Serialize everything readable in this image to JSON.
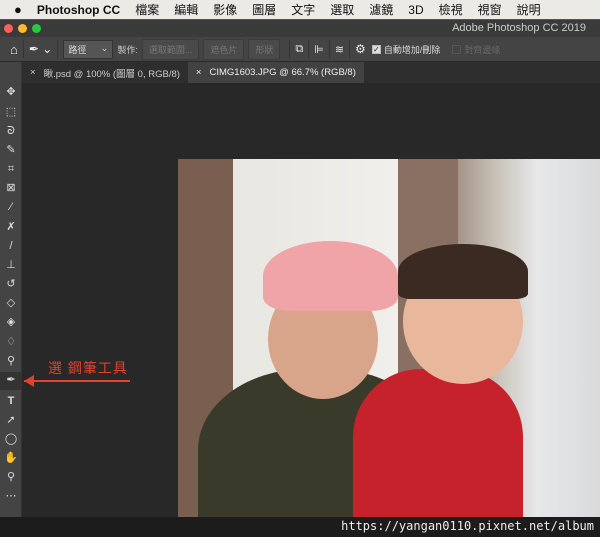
{
  "menubar": {
    "apple_icon": "apple-icon",
    "app": "Photoshop CC",
    "items": [
      "檔案",
      "編輯",
      "影像",
      "圖層",
      "文字",
      "選取",
      "濾鏡",
      "3D",
      "檢視",
      "視窗",
      "說明"
    ]
  },
  "window": {
    "title": "Adobe Photoshop CC 2019",
    "colors": {
      "close": "#fc5f57",
      "minimize": "#fdbc2e",
      "maximize": "#28c840"
    }
  },
  "options": {
    "mode_select": "路徑",
    "make_label": "製作:",
    "selection_btn": "選取範圍...",
    "mask_btn": "遮色片",
    "shape_btn": "形狀",
    "auto_add_delete": "自動增加/刪除",
    "auto_add_checked": true,
    "align_edges": "對齊邊緣",
    "align_checked": false
  },
  "tabs": [
    {
      "label": "瞅.psd @ 100% (圖層 0, RGB/8)",
      "active": false
    },
    {
      "label": "CIMG1603.JPG @ 66.7% (RGB/8)",
      "active": true
    }
  ],
  "annotation": {
    "text": "選 鋼筆工具",
    "color": "#e2412d"
  },
  "watermark": "https://yangan0110.pixnet.net/album"
}
